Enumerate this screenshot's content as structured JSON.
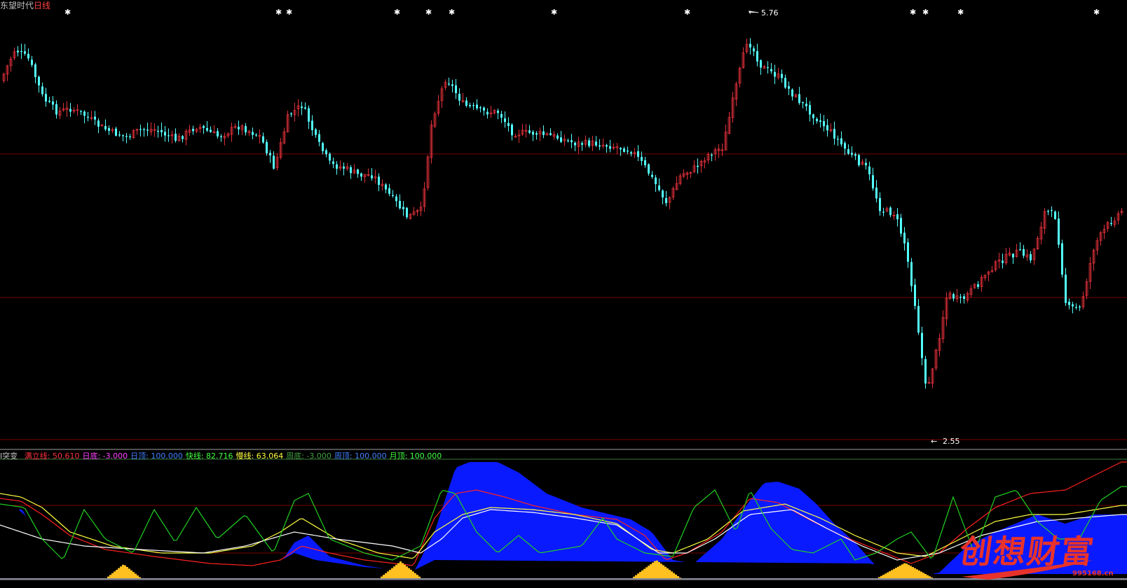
{
  "main_panel": {
    "stock_name": "东望时代",
    "period": "日线",
    "high_marker": "5.76",
    "low_marker": "2.55",
    "colors": {
      "up": "#e0303a",
      "down": "#54ffff",
      "grid": "#7a0000",
      "text": "#c0c0c0"
    }
  },
  "indicator_panel": {
    "name": "I突变",
    "readouts": [
      {
        "label": "满立线",
        "value": "50.610",
        "color": "#ff3040"
      },
      {
        "label": "日底",
        "value": "-3.000",
        "color": "#ff40ff"
      },
      {
        "label": "日顶",
        "value": "100.000",
        "color": "#4080ff"
      },
      {
        "label": "快线",
        "value": "82.716",
        "color": "#40ff40"
      },
      {
        "label": "慢线",
        "value": "63.064",
        "color": "#ffff40"
      },
      {
        "label": "周底",
        "value": "-3.000",
        "color": "#40a040"
      },
      {
        "label": "周顶",
        "value": "100.000",
        "color": "#4080ff"
      },
      {
        "label": "月顶",
        "value": "100.000",
        "color": "#40ff40"
      }
    ]
  },
  "watermark": {
    "text": "创想财富",
    "site": "995168.cn"
  }
}
